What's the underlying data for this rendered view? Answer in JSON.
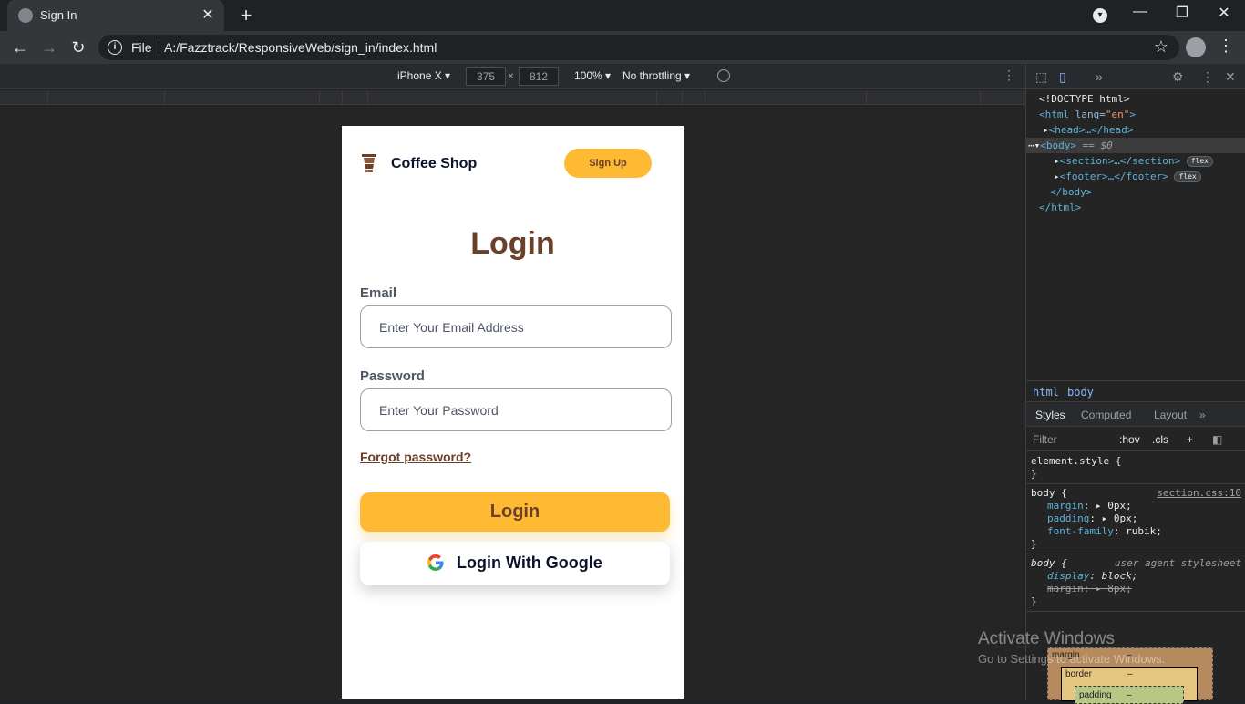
{
  "browser": {
    "tab_title": "Sign In",
    "url_scheme": "File",
    "url": "A:/Fazztrack/ResponsiveWeb/sign_in/index.html"
  },
  "device_toolbar": {
    "device": "iPhone X",
    "width": "375",
    "height": "812",
    "zoom": "100%",
    "throttling": "No throttling"
  },
  "page": {
    "brand": "Coffee Shop",
    "signup_label": "Sign Up",
    "heading": "Login",
    "email_label": "Email",
    "email_placeholder": "Enter Your Email Address",
    "password_label": "Password",
    "password_placeholder": "Enter Your Password",
    "forgot": "Forgot password?",
    "login_label": "Login",
    "google_label": "Login With Google",
    "colors": {
      "primary": "#ffba33",
      "brown": "#6a4029",
      "dark": "#0b132a"
    }
  },
  "devtools": {
    "dom": {
      "doctype": "<!DOCTYPE html>",
      "html_open": "<html",
      "lang_attr": " lang=",
      "lang_val": "\"en\"",
      "html_close_bracket": ">",
      "head": "<head>…</head>",
      "body_open": "<body>",
      "body_eq": " == $0",
      "section": "<section>…</section>",
      "footer": "<footer>…</footer>",
      "flex": "flex",
      "body_close": "</body>",
      "html_close": "</html>"
    },
    "crumbs": [
      "html",
      "body"
    ],
    "panel_tabs": [
      "Styles",
      "Computed",
      "Layout"
    ],
    "filter": "Filter",
    "hov": ":hov",
    "cls": ".cls",
    "styles": {
      "element_style": "element.style {",
      "close": "}",
      "rule1_selector": "body {",
      "rule1_source": "section.css:10",
      "rule1_props": [
        {
          "name": "margin",
          "value": "0px;"
        },
        {
          "name": "padding",
          "value": "0px;"
        },
        {
          "name": "font-family",
          "value": "rubik;"
        }
      ],
      "rule2_selector": "body {",
      "rule2_source": "user agent stylesheet",
      "rule2_display": "display",
      "rule2_display_val": "block;",
      "rule2_margin": "margin:",
      "rule2_margin_val": "8px;"
    },
    "boxmodel": {
      "margin": "margin",
      "border": "border",
      "padding": "padding",
      "dash": "–"
    }
  },
  "watermark": {
    "line1": "Activate Windows",
    "line2": "Go to Settings to activate Windows."
  }
}
